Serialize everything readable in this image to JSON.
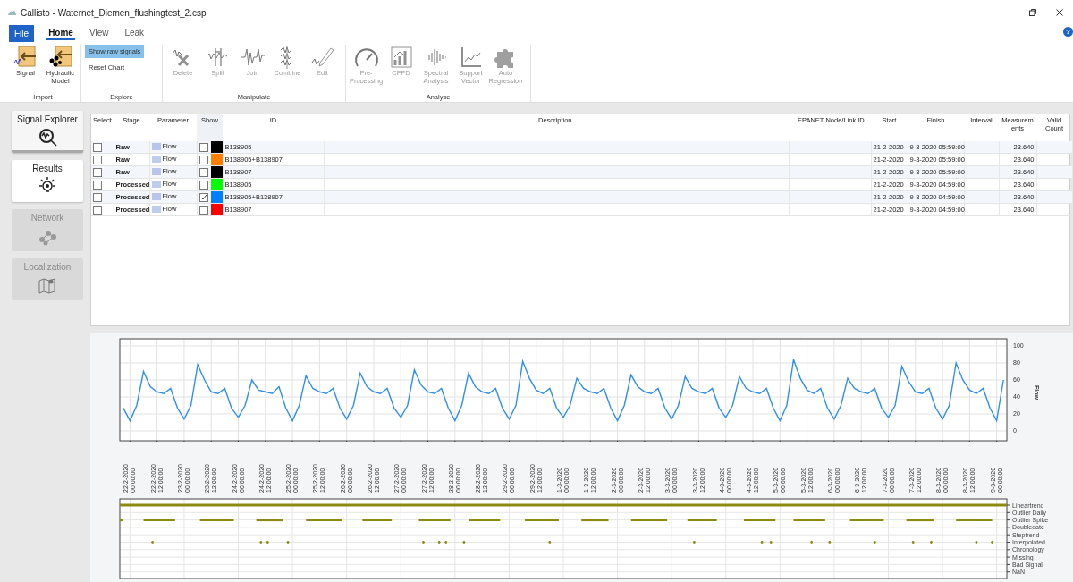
{
  "window": {
    "title": "Callisto - Waternet_Diemen_flushingtest_2.csp"
  },
  "file_button": "File",
  "menu_tabs": [
    {
      "label": "Home",
      "selected": true
    },
    {
      "label": "View",
      "selected": false
    },
    {
      "label": "Leak",
      "selected": false
    }
  ],
  "help": "?",
  "ribbon": {
    "groups": [
      {
        "label": "Import",
        "kind": "large",
        "items": [
          {
            "label": "Signal",
            "disabled": false
          },
          {
            "label": "Hydraulic Model",
            "disabled": false
          }
        ]
      },
      {
        "label": "Explore",
        "kind": "text",
        "items": [
          {
            "label": "Show raw signals",
            "on": true
          },
          {
            "label": "Reset Chart",
            "on": false
          }
        ]
      },
      {
        "label": "Manipulate",
        "kind": "large",
        "items": [
          {
            "label": "Delete",
            "disabled": true
          },
          {
            "label": "Split",
            "disabled": true
          },
          {
            "label": "Join",
            "disabled": true
          },
          {
            "label": "Combine",
            "disabled": true
          },
          {
            "label": "Edit",
            "disabled": true
          }
        ]
      },
      {
        "label": "Analyse",
        "kind": "large",
        "items": [
          {
            "label": "Pre-Processing",
            "disabled": true
          },
          {
            "label": "CFPD",
            "disabled": true
          },
          {
            "label": "Spectral Analysis",
            "disabled": true
          },
          {
            "label": "Support Vector",
            "disabled": true
          },
          {
            "label": "Auto Regression",
            "disabled": true
          }
        ]
      }
    ]
  },
  "sidebar": {
    "items": [
      {
        "label": "Signal Explorer",
        "selected": true,
        "disabled": false
      },
      {
        "label": "Results",
        "selected": false,
        "disabled": false
      },
      {
        "label": "Network",
        "selected": false,
        "disabled": true
      },
      {
        "label": "Localization",
        "selected": false,
        "disabled": true
      }
    ]
  },
  "table": {
    "columns": [
      "Select",
      "Stage",
      "Parameter",
      "Show",
      "ID",
      "Description",
      "EPANET Node/Link ID",
      "Start",
      "Finish",
      "Interval",
      "Measurements",
      "Valid Count"
    ],
    "rows": [
      {
        "checked": false,
        "stage": "Raw",
        "parameter": "Flow",
        "show": false,
        "color": "#000000",
        "id": "B138905",
        "start": "21-2-2020",
        "finish": "9-3-2020 05:59:00",
        "measurements": "23.640"
      },
      {
        "checked": false,
        "stage": "Raw",
        "parameter": "Flow",
        "show": false,
        "color": "#ff8000",
        "id": "B138905+B138907",
        "start": "21-2-2020",
        "finish": "9-3-2020 05:59:00",
        "measurements": "23.640"
      },
      {
        "checked": false,
        "stage": "Raw",
        "parameter": "Flow",
        "show": false,
        "color": "#000000",
        "id": "B138907",
        "start": "21-2-2020",
        "finish": "9-3-2020 05:59:00",
        "measurements": "23.640"
      },
      {
        "checked": false,
        "stage": "Processed",
        "parameter": "Flow",
        "show": false,
        "color": "#00ff00",
        "id": "B138905",
        "start": "21-2-2020",
        "finish": "9-3-2020 04:59:00",
        "measurements": "23.640"
      },
      {
        "checked": false,
        "stage": "Processed",
        "parameter": "Flow",
        "show": true,
        "color": "#0080ff",
        "id": "B138905+B138907",
        "start": "21-2-2020",
        "finish": "9-3-2020 04:59:00",
        "measurements": "23.640"
      },
      {
        "checked": false,
        "stage": "Processed",
        "parameter": "Flow",
        "show": false,
        "color": "#ff0000",
        "id": "B138907",
        "start": "21-2-2020",
        "finish": "9-3-2020 04:59:00",
        "measurements": "23.640"
      }
    ]
  },
  "flow_chart": {
    "chart_data": {
      "type": "line",
      "grid": true,
      "ylabel": "Flow",
      "ylim": [
        -11.6,
        108.4
      ],
      "yticks": [
        0,
        20,
        40,
        60,
        80,
        100
      ],
      "categories": [
        null,
        "22-2-2020 00:00:00",
        null,
        null,
        null,
        "22-2-2020 12:00:00",
        null,
        null,
        null,
        "23-2-2020 00:00:00",
        null,
        null,
        null,
        "23-2-2020 12:00:00",
        null,
        null,
        null,
        "24-2-2020 00:00:00",
        null,
        null,
        null,
        "24-2-2020 12:00:00",
        null,
        null,
        null,
        "25-2-2020 00:00:00",
        null,
        null,
        null,
        "25-2-2020 12:00:00",
        null,
        null,
        null,
        "26-2-2020 00:00:00",
        null,
        null,
        null,
        "26-2-2020 12:00:00",
        null,
        null,
        null,
        "27-2-2020 00:00:00",
        null,
        null,
        null,
        "27-2-2020 12:00:00",
        null,
        null,
        null,
        "28-2-2020 00:00:00",
        null,
        null,
        null,
        "28-2-2020 12:00:00",
        null,
        null,
        null,
        "29-2-2020 00:00:00",
        null,
        null,
        null,
        "29-2-2020 12:00:00",
        null,
        null,
        null,
        "1-3-2020 00:00:00",
        null,
        null,
        null,
        "1-3-2020 12:00:00",
        null,
        null,
        null,
        "2-3-2020 00:00:00",
        null,
        null,
        null,
        "2-3-2020 12:00:00",
        null,
        null,
        null,
        "3-3-2020 00:00:00",
        null,
        null,
        null,
        "3-3-2020 12:00:00",
        null,
        null,
        null,
        "4-3-2020 00:00:00",
        null,
        null,
        null,
        "4-3-2020 12:00:00",
        null,
        null,
        null,
        "5-3-2020 00:00:00",
        null,
        null,
        null,
        "5-3-2020 12:00:00",
        null,
        null,
        null,
        "6-3-2020 00:00:00",
        null,
        null,
        null,
        "6-3-2020 12:00:00",
        null,
        null,
        null,
        "7-3-2020 00:00:00",
        null,
        null,
        null,
        "7-3-2020 12:00:00",
        null,
        null,
        null,
        "8-3-2020 00:00:00",
        null,
        null,
        null,
        "8-3-2020 12:00:00",
        null,
        null,
        null,
        "9-3-2020 00:00:00",
        null
      ],
      "series": [
        {
          "color": "#2f8ff0",
          "values": [
            27,
            12,
            30,
            70,
            52,
            46,
            44,
            50,
            27,
            14,
            30,
            78,
            60,
            46,
            44,
            50,
            27,
            16,
            30,
            60,
            48,
            46,
            44,
            52,
            27,
            12,
            30,
            65,
            50,
            46,
            44,
            50,
            27,
            14,
            30,
            68,
            52,
            46,
            44,
            50,
            27,
            16,
            30,
            72,
            54,
            46,
            44,
            50,
            27,
            12,
            30,
            68,
            52,
            46,
            44,
            50,
            27,
            14,
            30,
            82,
            62,
            48,
            44,
            50,
            27,
            16,
            30,
            62,
            50,
            46,
            44,
            50,
            27,
            12,
            30,
            66,
            52,
            46,
            44,
            50,
            27,
            14,
            30,
            64,
            50,
            46,
            44,
            50,
            27,
            16,
            30,
            64,
            50,
            46,
            44,
            50,
            27,
            12,
            30,
            84,
            62,
            48,
            44,
            50,
            27,
            14,
            30,
            62,
            50,
            46,
            44,
            50,
            27,
            16,
            30,
            76,
            58,
            46,
            44,
            50,
            27,
            14,
            30,
            80,
            60,
            48,
            44,
            50,
            27,
            12,
            60
          ]
        }
      ]
    }
  },
  "event_chart": {
    "categories": [
      "Lineartrend",
      "Outlier Daily",
      "Outlier Spike",
      "Doubledate",
      "Steptrend",
      "Interpolated",
      "Chronology",
      "Missing",
      "Bad Signal",
      "NaN"
    ]
  }
}
